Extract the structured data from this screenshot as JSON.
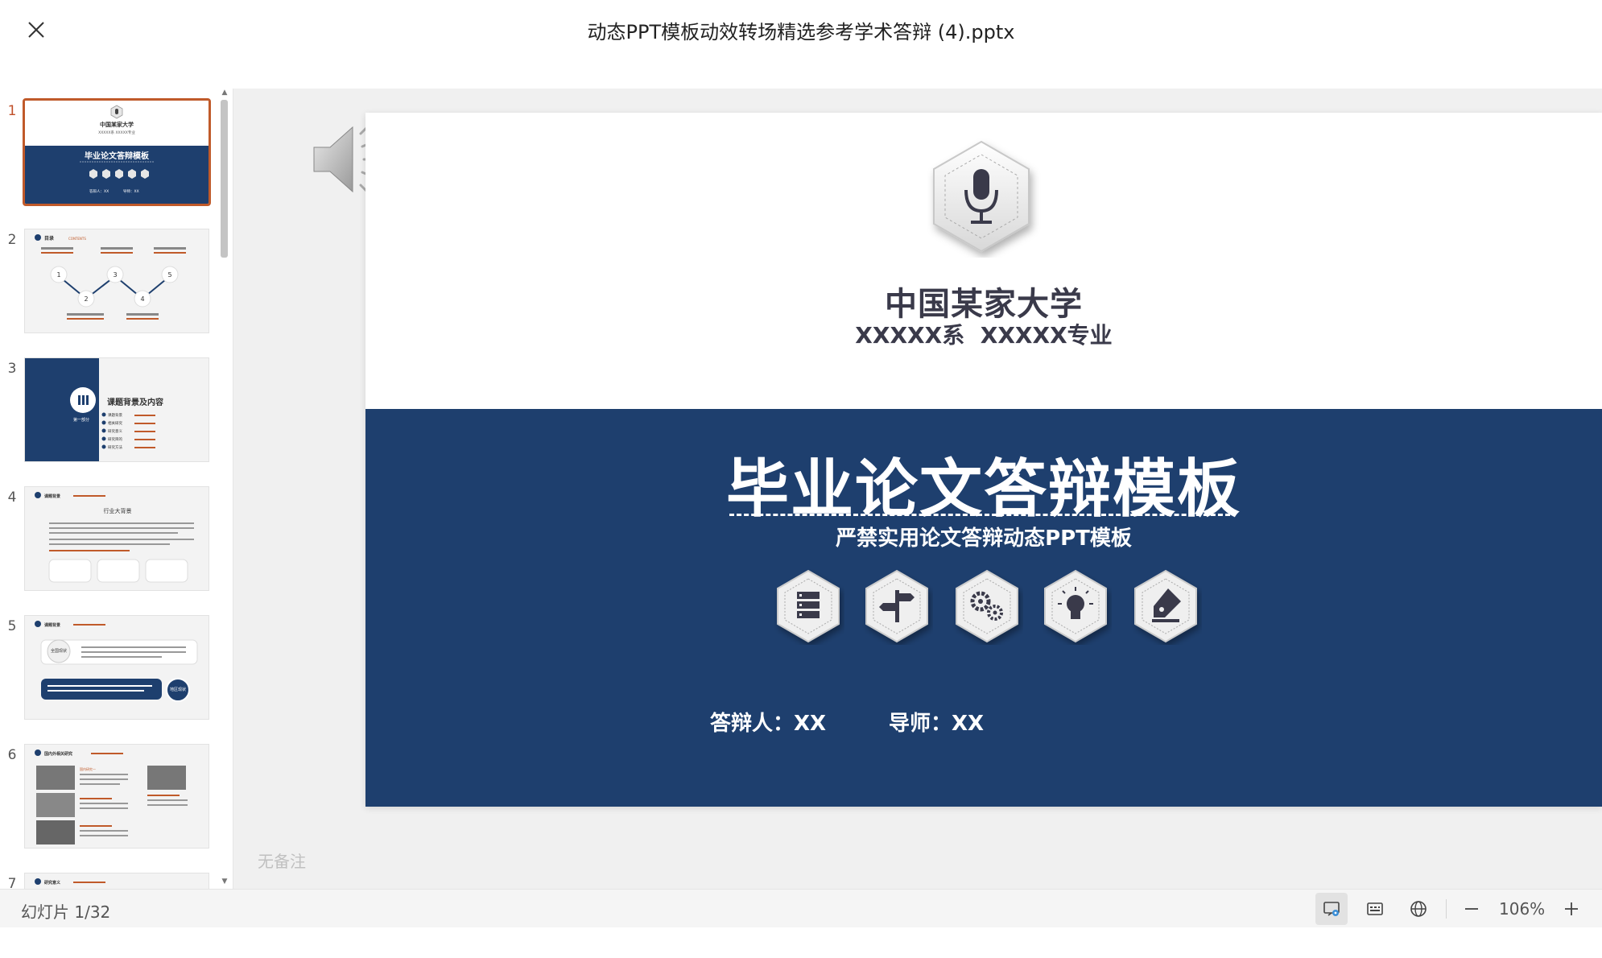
{
  "window": {
    "title": "动态PPT模板动效转场精选参考学术答辩 (4).pptx"
  },
  "thumbnails": {
    "items": [
      {
        "number": "1",
        "texts": [
          "中国某家大学",
          "XXXXX系 XXXXX专业",
          "毕业论文答辩模板",
          "答辩人：XX",
          "导师：XX"
        ]
      },
      {
        "number": "2",
        "texts": [
          "目录",
          "CONTENTS",
          "1",
          "2",
          "3",
          "4",
          "5"
        ]
      },
      {
        "number": "3",
        "texts": [
          "第一部分",
          "课题背景及内容",
          "课题背景",
          "相关研究",
          "研究意义",
          "研究目的",
          "研究方法"
        ]
      },
      {
        "number": "4",
        "texts": [
          "课题背景",
          "行业大背景"
        ]
      },
      {
        "number": "5",
        "texts": [
          "课题背景",
          "全国现状",
          "地区现状"
        ]
      },
      {
        "number": "6",
        "texts": [
          "国内外相关研究",
          "国内研究一"
        ]
      },
      {
        "number": "7",
        "texts": [
          "研究意义"
        ]
      }
    ]
  },
  "slide": {
    "university": "中国某家大学",
    "department": "XXXXX系  XXXXX专业",
    "title": "毕业论文答辩模板",
    "subtitle": "严禁实用论文答辩动态PPT模板",
    "presenter": "答辩人：XX",
    "advisor": "导师：XX",
    "icons": [
      "server-icon",
      "signpost-icon",
      "gears-icon",
      "lightbulb-icon",
      "pen-icon"
    ]
  },
  "notes": {
    "placeholder": "无备注"
  },
  "statusbar": {
    "slide_counter": "幻灯片 1/32",
    "zoom": "106%"
  },
  "colors": {
    "slide_blue": "#1e3f6e",
    "active_thumb_border": "#c05a2a"
  }
}
